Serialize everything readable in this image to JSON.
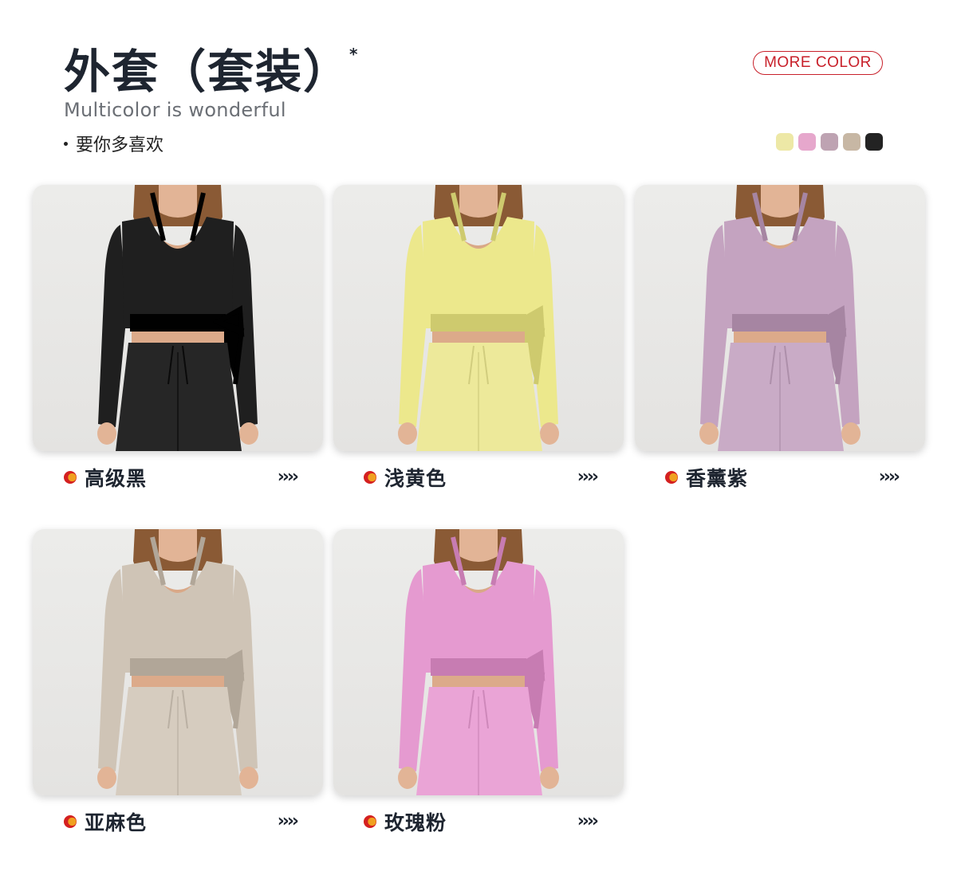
{
  "header": {
    "title": "外套（套装）",
    "title_mark": "*",
    "subtitle": "Multicolor is wonderful",
    "tagline": "要你多喜欢",
    "more_color_button": "MORE COLOR"
  },
  "swatches": [
    {
      "color": "#ede8a6"
    },
    {
      "color": "#e6a7cc"
    },
    {
      "color": "#bea3b2"
    },
    {
      "color": "#c7b7a4"
    },
    {
      "color": "#232323"
    }
  ],
  "products": [
    {
      "name": "高级黑",
      "arrows": "››››",
      "top_color": "#1f1f1f",
      "pants_color": "#262626"
    },
    {
      "name": "浅黄色",
      "arrows": "››››",
      "top_color": "#ece88c",
      "pants_color": "#ede99a"
    },
    {
      "name": "香薰紫",
      "arrows": "››››",
      "top_color": "#c4a3c0",
      "pants_color": "#c9abc6"
    },
    {
      "name": "亚麻色",
      "arrows": "››››",
      "top_color": "#cfc4b6",
      "pants_color": "#d6ccbf"
    },
    {
      "name": "玫瑰粉",
      "arrows": "››››",
      "top_color": "#e59ad0",
      "pants_color": "#eaa4d6"
    }
  ]
}
